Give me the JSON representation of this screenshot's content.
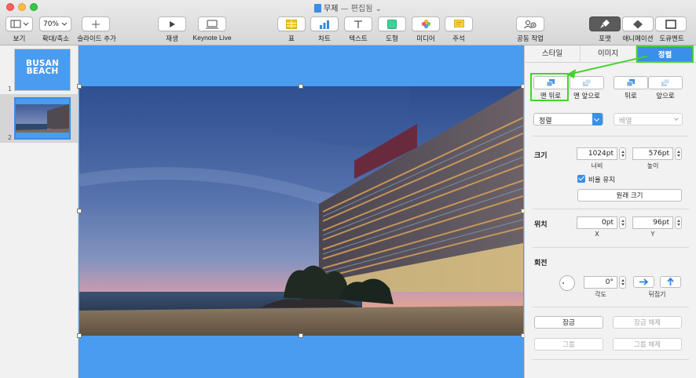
{
  "window": {
    "title": "무제",
    "state": "— 편집됨 ⌄"
  },
  "toolbar": {
    "view": "보기",
    "zoom_value": "70%",
    "zoom_label": "확대/축소",
    "add_slide": "슬라이드 추가",
    "play": "재생",
    "keynote_live": "Keynote Live",
    "table": "표",
    "chart": "차트",
    "text": "텍스트",
    "shape": "도형",
    "media": "미디어",
    "comment": "주석",
    "collaborate": "공동 작업",
    "format": "포맷",
    "animate": "애니메이션",
    "document": "도큐멘트"
  },
  "navigator": {
    "slides": [
      {
        "number": "1",
        "title_line1": "BUSAN",
        "title_line2": "BEACH"
      },
      {
        "number": "2"
      }
    ]
  },
  "inspector": {
    "tabs": [
      "스타일",
      "이미지",
      "정렬"
    ],
    "active_tab": "정렬",
    "arrange": {
      "back": "맨 뒤로",
      "front": "맨 앞으로",
      "backward": "뒤로",
      "forward": "앞으로",
      "align": "정렬",
      "distribute": "배열"
    },
    "size": {
      "label": "크기",
      "width": "1024pt",
      "height": "576pt",
      "width_label": "너비",
      "height_label": "높이",
      "constrain": "비율 유지",
      "original": "원래 크기"
    },
    "position": {
      "label": "위치",
      "x": "0pt",
      "y": "96pt",
      "x_label": "X",
      "y_label": "Y"
    },
    "rotate": {
      "label": "회전",
      "angle": "0°",
      "angle_label": "각도",
      "flip_label": "뒤집기"
    },
    "lock": {
      "lock": "잠금",
      "unlock": "잠금 해제",
      "group": "그룹",
      "ungroup": "그룹 해제"
    }
  },
  "colors": {
    "accent": "#3a8fe8",
    "highlight": "#47d12f",
    "canvas": "#4a9cf0"
  }
}
